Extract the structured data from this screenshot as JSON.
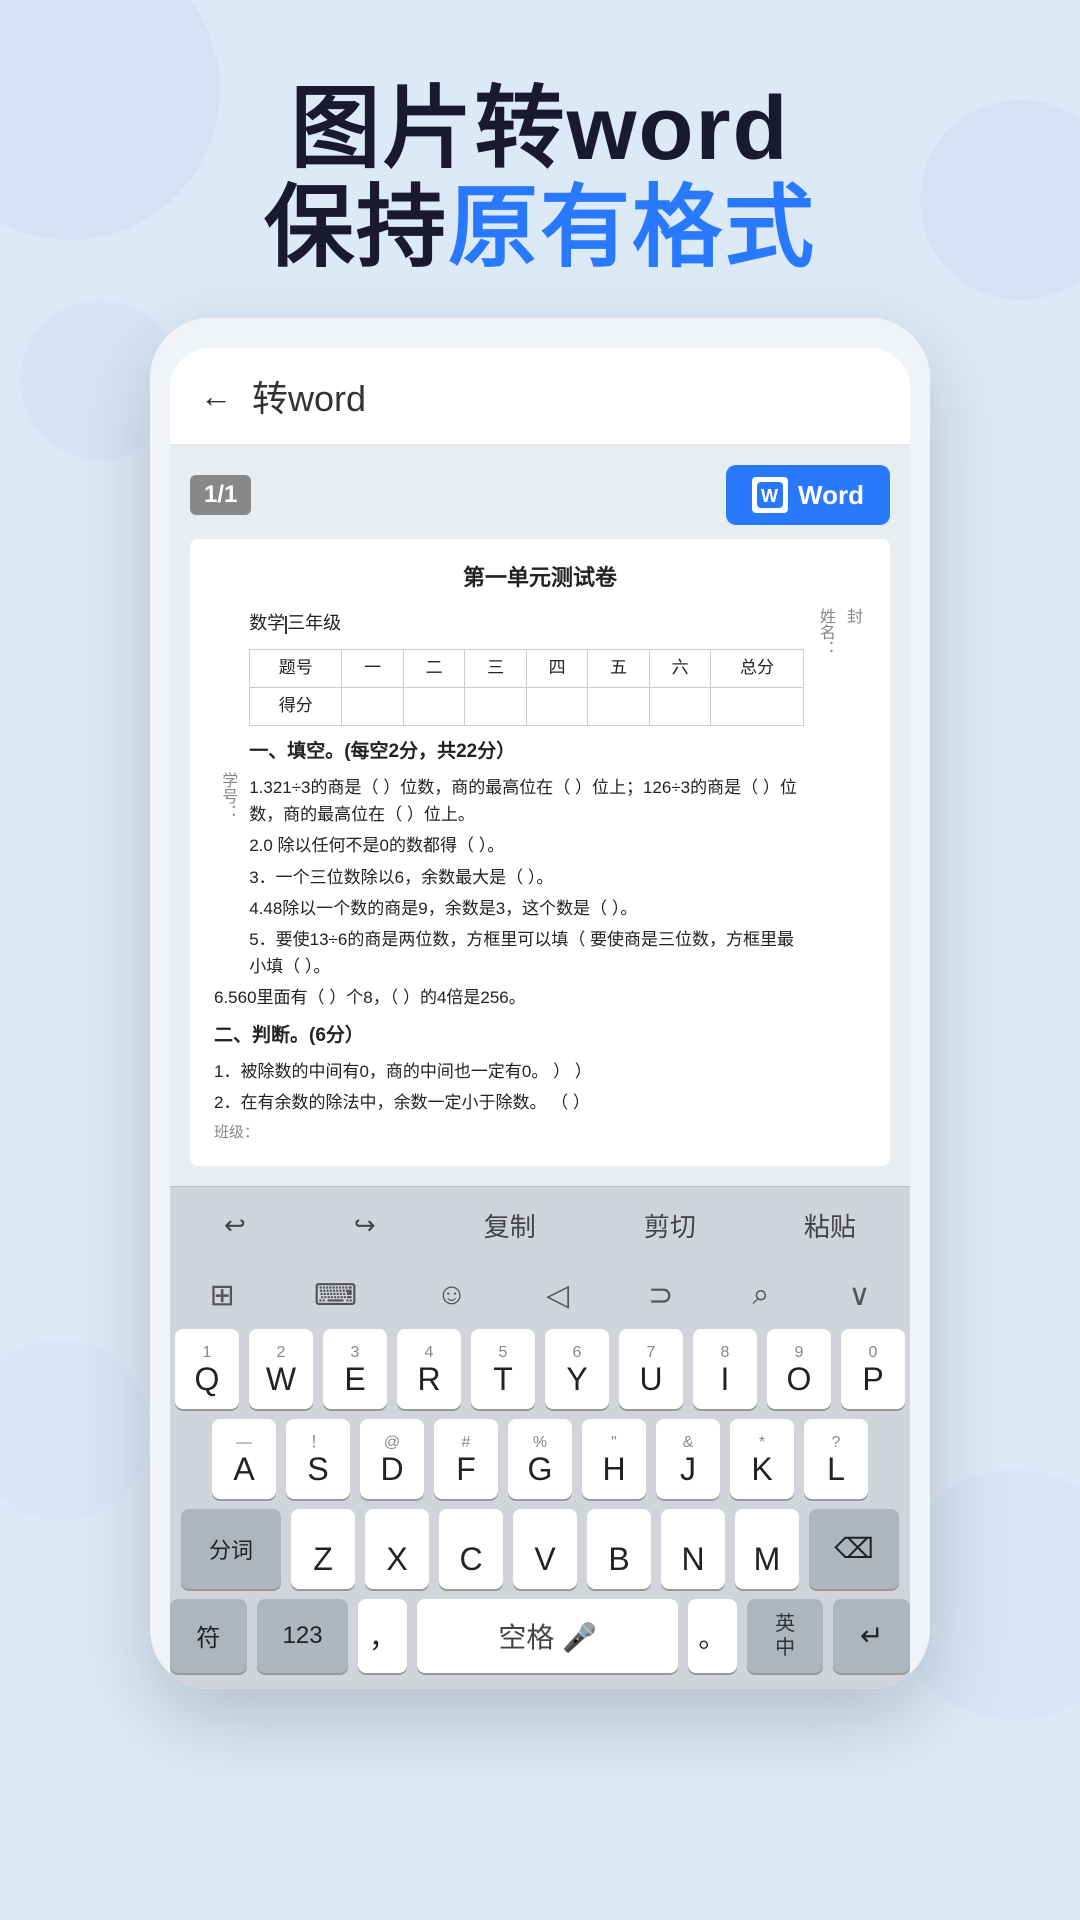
{
  "hero": {
    "line1": "图片转word",
    "line2_prefix": "保持",
    "line2_blue": "原有格式",
    "line2_suffix": ""
  },
  "app": {
    "back_label": "←",
    "title": "转word",
    "page_indicator": "1/1",
    "word_button": "Word",
    "doc": {
      "title": "第一单元测试卷",
      "label_xue": "学号：",
      "value_xue": "数学|三年级",
      "table_headers": [
        "题号",
        "一",
        "二",
        "三",
        "四",
        "五",
        "六",
        "总分"
      ],
      "table_row": [
        "得分",
        "",
        "",
        "",
        "",
        "",
        "",
        ""
      ],
      "section1": "一、填空。(每空2分，共22分）",
      "items": [
        "1.321÷3的商是（  ）位数，商的最高位在（  ）位上；126÷3的商是（  ）位数，商的最高位在（  ）位上。",
        "2.0 除以任何不是0的数都得（  ）。",
        "3．一个三位数除以6，余数最大是（  ）。",
        "4.48除以一个数的商是9，余数是3，这个数是（  ）。",
        "5．要使13÷6的商是两位数，方框里可以填（  要使商是三位数，方框里最小填（  ）。",
        "6.560里面有（  ）个8，（  ）的4倍是256。"
      ],
      "section2": "二、判断。(6分）",
      "judge_items": [
        "1．被除数的中间有0，商的中间也一定有0。  ）           ）",
        "2．在有余数的除法中，余数一定小于除数。  （  ）"
      ],
      "label_xing": "姓名：\n封",
      "label_zu": "班级："
    },
    "toolbar": {
      "undo": "↩",
      "redo": "↪",
      "copy": "复制",
      "cut": "剪切",
      "paste": "粘贴"
    },
    "kb_icons": [
      "⊞",
      "⌨",
      "☺",
      "◁",
      "∞",
      "⌕",
      "∨"
    ],
    "keyboard": {
      "row1": [
        {
          "top": "1",
          "main": "Q"
        },
        {
          "top": "2",
          "main": "W"
        },
        {
          "top": "3",
          "main": "E"
        },
        {
          "top": "4",
          "main": "R"
        },
        {
          "top": "5",
          "main": "T"
        },
        {
          "top": "6",
          "main": "Y"
        },
        {
          "top": "7",
          "main": "U"
        },
        {
          "top": "8",
          "main": "I"
        },
        {
          "top": "9",
          "main": "O"
        },
        {
          "top": "0",
          "main": "P"
        }
      ],
      "row2": [
        {
          "top": "—",
          "main": "A"
        },
        {
          "top": "！",
          "main": "S"
        },
        {
          "top": "@",
          "main": "D"
        },
        {
          "top": "#",
          "main": "F"
        },
        {
          "top": "%",
          "main": "G"
        },
        {
          "top": "\"",
          "main": "H"
        },
        {
          "top": "&",
          "main": "J"
        },
        {
          "top": "*",
          "main": "K"
        },
        {
          "top": "?",
          "main": "L"
        }
      ],
      "row3_main": [
        "Z",
        "X",
        "C",
        "V",
        "B",
        "N",
        "M"
      ],
      "shift_label": "分词",
      "backspace_label": "⌫",
      "bottom": {
        "fn_label": "符",
        "num_label": "123",
        "comma_label": "，",
        "space_label": "空格",
        "mic_label": "🎤",
        "period_label": "。",
        "lang_label": "英\n中",
        "enter_label": "↵"
      }
    }
  }
}
